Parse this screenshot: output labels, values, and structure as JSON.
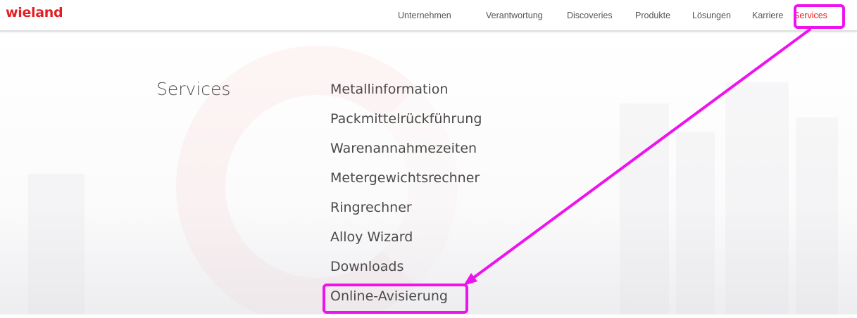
{
  "header": {
    "logo_text": "wieland",
    "nav": [
      {
        "label": "Unternehmen"
      },
      {
        "label": "Verantwortung"
      },
      {
        "label": "Discoveries"
      },
      {
        "label": "Produkte"
      },
      {
        "label": "Lösungen"
      },
      {
        "label": "Karriere"
      },
      {
        "label": "Services",
        "active": true
      }
    ]
  },
  "main": {
    "section_title": "Services",
    "links": [
      {
        "label": "Metallinformation"
      },
      {
        "label": "Packmittelrückführung"
      },
      {
        "label": "Warenannahmezeiten"
      },
      {
        "label": "Metergewichtsrechner"
      },
      {
        "label": "Ringrechner"
      },
      {
        "label": "Alloy Wizard"
      },
      {
        "label": "Downloads"
      },
      {
        "label": "Online-Avisierung",
        "highlighted": true
      }
    ]
  },
  "colors": {
    "brand": "#e31e24",
    "annotation": "#ee12ee",
    "text": "#4a4a4a"
  }
}
